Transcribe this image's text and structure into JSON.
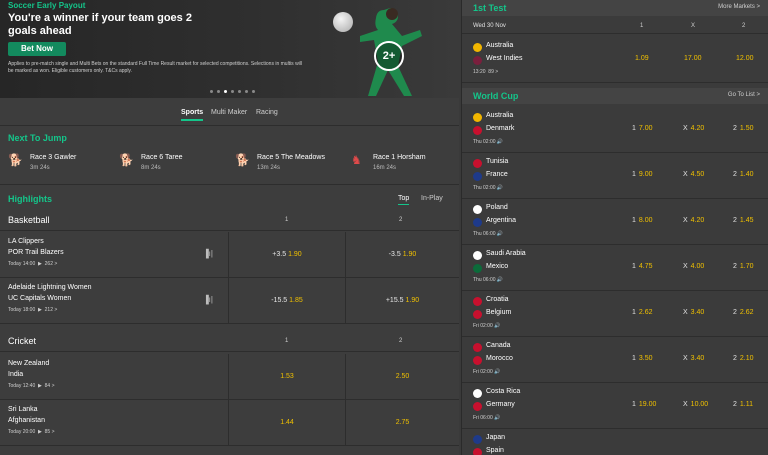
{
  "banner": {
    "tag": "Soccer Early Payout",
    "headline": "You're a winner if your team goes 2 goals ahead",
    "cta": "Bet Now",
    "terms": "Applies to pre-match single and Multi Bets on the standard Full Time Result market for selected competitions. Selections in multis will be marked as won. Eligible customers only. T&Cs apply.",
    "badge": "2+"
  },
  "nav": {
    "tabs": [
      "Sports",
      "Multi Maker",
      "Racing"
    ]
  },
  "next_to_jump": {
    "title": "Next To Jump",
    "races": [
      {
        "name": "Race 3 Gawler",
        "time": "3m 24s",
        "icon": "greyhound-icon"
      },
      {
        "name": "Race 6 Taree",
        "time": "8m 24s",
        "icon": "greyhound-icon"
      },
      {
        "name": "Race 5 The Meadows",
        "time": "13m 24s",
        "icon": "greyhound-icon"
      },
      {
        "name": "Race 1 Horsham",
        "time": "16m 24s",
        "icon": "harness-icon"
      }
    ]
  },
  "highlights": {
    "title": "Highlights",
    "tabs": [
      "Top",
      "In-Play"
    ],
    "sports": [
      {
        "name": "Basketball",
        "col1": "1",
        "col2": "2",
        "matches": [
          {
            "team1": "LA Clippers",
            "team2": "POR Trail Blazers",
            "time": "Today 14:00",
            "count": "262 >",
            "o1_line": "+3.5",
            "o1": "1.90",
            "o2_line": "-3.5",
            "o2": "1.90"
          },
          {
            "team1": "Adelaide Lightning Women",
            "team2": "UC Capitals Women",
            "time": "Today 18:00",
            "count": "212 >",
            "o1_line": "-15.5",
            "o1": "1.85",
            "o2_line": "+15.5",
            "o2": "1.90"
          }
        ]
      },
      {
        "name": "Cricket",
        "col1": "1",
        "col2": "2",
        "matches": [
          {
            "team1": "New Zealand",
            "team2": "India",
            "time": "Today 12:40",
            "count": "84 >",
            "o1_line": "",
            "o1": "1.53",
            "o2_line": "",
            "o2": "2.50"
          },
          {
            "team1": "Sri Lanka",
            "team2": "Afghanistan",
            "time": "Today 20:00",
            "count": "85 >",
            "o1_line": "",
            "o1": "1.44",
            "o2_line": "",
            "o2": "2.75"
          }
        ]
      }
    ]
  },
  "right": {
    "first_test": {
      "title": "1st Test",
      "more": "More Markets >",
      "date": "Wed 30 Nov",
      "h1": "1",
      "hx": "X",
      "h2": "2",
      "team1": "Australia",
      "team2": "West Indies",
      "time": "13:20",
      "count": "89 >",
      "o1": "1.09",
      "ox": "17.00",
      "o2": "12.00"
    },
    "world_cup": {
      "title": "World Cup",
      "go": "Go To List >",
      "lbl1": "1",
      "lblx": "X",
      "lbl2": "2",
      "matches": [
        {
          "team1": "Australia",
          "team2": "Denmark",
          "time": "Thu 02:00",
          "o1": "7.00",
          "ox": "4.20",
          "o2": "1.50",
          "c1": "#f2b600",
          "c2": "#c8102e"
        },
        {
          "team1": "Tunisia",
          "team2": "France",
          "time": "Thu 02:00",
          "o1": "9.00",
          "ox": "4.50",
          "o2": "1.40",
          "c1": "#c8102e",
          "c2": "#1e3a8a"
        },
        {
          "team1": "Poland",
          "team2": "Argentina",
          "time": "Thu 06:00",
          "o1": "8.00",
          "ox": "4.20",
          "o2": "1.45",
          "c1": "#ffffff",
          "c2": "#1e3a8a"
        },
        {
          "team1": "Saudi Arabia",
          "team2": "Mexico",
          "time": "Thu 06:00",
          "o1": "4.75",
          "ox": "4.00",
          "o2": "1.70",
          "c1": "#ffffff",
          "c2": "#0b6b3a"
        },
        {
          "team1": "Croatia",
          "team2": "Belgium",
          "time": "Fri 02:00",
          "o1": "2.62",
          "ox": "3.40",
          "o2": "2.62",
          "c1": "#c8102e",
          "c2": "#c8102e"
        },
        {
          "team1": "Canada",
          "team2": "Morocco",
          "time": "Fri 02:00",
          "o1": "3.50",
          "ox": "3.40",
          "o2": "2.10",
          "c1": "#c8102e",
          "c2": "#c8102e"
        },
        {
          "team1": "Costa Rica",
          "team2": "Germany",
          "time": "Fri 06:00",
          "o1": "19.00",
          "ox": "10.00",
          "o2": "1.11",
          "c1": "#ffffff",
          "c2": "#c8102e"
        },
        {
          "team1": "Japan",
          "team2": "Spain",
          "time": "",
          "o1": "",
          "ox": "",
          "o2": "",
          "c1": "#1e3a8a",
          "c2": "#c8102e"
        }
      ]
    }
  }
}
